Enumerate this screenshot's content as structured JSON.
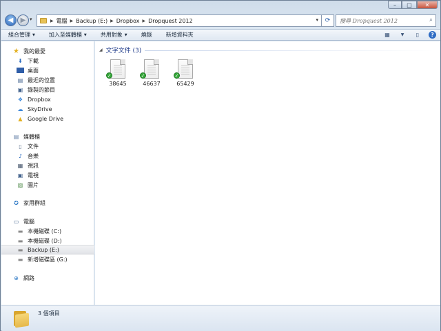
{
  "window": {
    "caption": {
      "minimize": "–",
      "maximize": "□",
      "close": "✕"
    }
  },
  "navigation": {
    "back_icon": "◀",
    "forward_icon": "▶",
    "history_icon": "▾",
    "breadcrumbs": [
      "電腦",
      "Backup (E:)",
      "Dropbox",
      "Dropquest 2012"
    ],
    "search_placeholder": "搜尋 Dropquest 2012"
  },
  "toolbar": {
    "items": [
      "組合管理",
      "加入至媒體櫃",
      "共用對象",
      "燒錄",
      "新增資料夾"
    ],
    "has_dropdown": [
      true,
      true,
      true,
      false,
      false
    ]
  },
  "sidebar": {
    "favorites_header": "我的最愛",
    "favorites": [
      "下載",
      "桌面",
      "最近的位置",
      "錄製的節目",
      "Dropbox",
      "SkyDrive",
      "Google Drive"
    ],
    "libraries_header": "媒體櫃",
    "libraries": [
      "文件",
      "音樂",
      "視訊",
      "電視",
      "圖片"
    ],
    "homegroup": "家用群組",
    "computer_header": "電腦",
    "drives": [
      "本機磁碟 (C:)",
      "本機磁碟 (D:)",
      "Backup (E:)",
      "新增磁碟區 (G:)"
    ],
    "selected": "Backup (E:)",
    "network": "網路"
  },
  "content": {
    "group_header": "文字文件 (3)",
    "files": [
      {
        "name": "38645",
        "sync_status": "synced"
      },
      {
        "name": "46637",
        "sync_status": "synced"
      },
      {
        "name": "65429",
        "sync_status": "synced"
      }
    ]
  },
  "details": {
    "status": "3 個項目"
  },
  "colors": {
    "accent": "#2a63b8",
    "group_header": "#1f3b8a",
    "sync_ok": "#36a83a"
  }
}
